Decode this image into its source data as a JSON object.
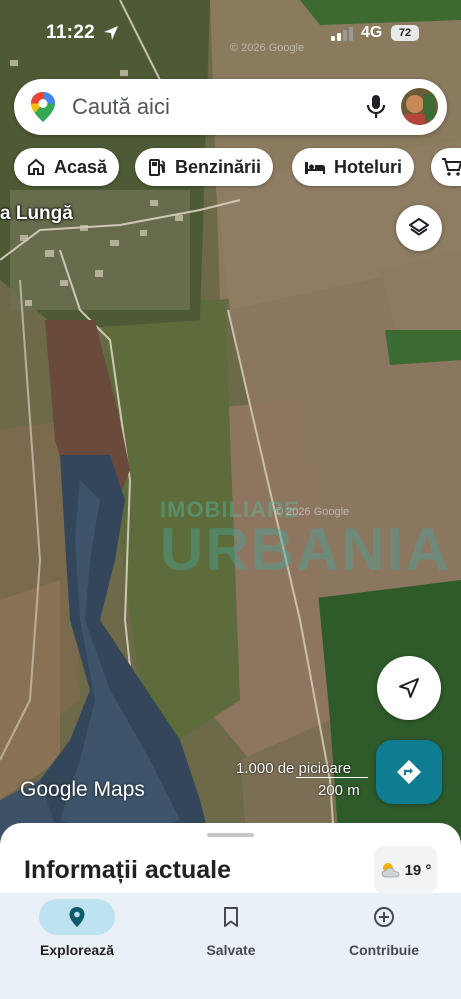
{
  "status_bar": {
    "time": "11:22",
    "network": "4G",
    "battery": "72"
  },
  "search": {
    "placeholder": "Caută aici"
  },
  "chips": [
    {
      "label": "Acasă",
      "icon": "home-icon"
    },
    {
      "label": "Benzinării",
      "icon": "gas-station-icon"
    },
    {
      "label": "Hoteluri",
      "icon": "bed-icon"
    },
    {
      "label": "",
      "icon": "shopping-cart-icon"
    }
  ],
  "map": {
    "place_label": "a Lungă",
    "copyright_top": "© 2026 Google",
    "copyright_mid": "© 2026 Google",
    "watermark_small": "IMOBILIARE",
    "watermark_large": "URBANIA",
    "logo": "Google Maps",
    "scale_feet": "1.000 de picioare",
    "scale_meters": "200 m"
  },
  "sheet": {
    "title": "Informații actuale",
    "weather": "19 °"
  },
  "bottom_nav": {
    "items": [
      {
        "label": "Explorează",
        "icon": "location-pin-icon",
        "active": true
      },
      {
        "label": "Salvate",
        "icon": "bookmark-icon",
        "active": false
      },
      {
        "label": "Contribuie",
        "icon": "add-circle-icon",
        "active": false
      }
    ]
  },
  "colors": {
    "accent": "#0e7d91",
    "active_pill": "#bde3f0",
    "nav_background": "#e9f1f7"
  }
}
